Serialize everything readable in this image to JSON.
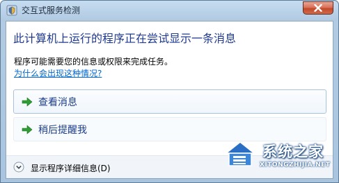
{
  "window": {
    "title": "交互式服务检测",
    "close_icon": "close-icon"
  },
  "dialog": {
    "heading": "此计算机上运行的程序正在尝试显示一条消息",
    "description": "程序可能需要您的信息或权限来完成任务。",
    "help_link": "为什么会出现这种情况?"
  },
  "commands": [
    {
      "label": "查看消息",
      "icon": "green-arrow-icon"
    },
    {
      "label": "稍后提醒我",
      "icon": "green-arrow-icon"
    }
  ],
  "footer": {
    "details_label": "显示程序详细信息(D)",
    "details_icon": "chevron-down-icon"
  },
  "watermark": {
    "site_name": "系统之家",
    "url": "XITONGZHIJIA.NET"
  },
  "colors": {
    "heading": "#1f3a8f",
    "link": "#0066cc",
    "arrow": "#2e9e32",
    "close": "#c24a2c"
  }
}
